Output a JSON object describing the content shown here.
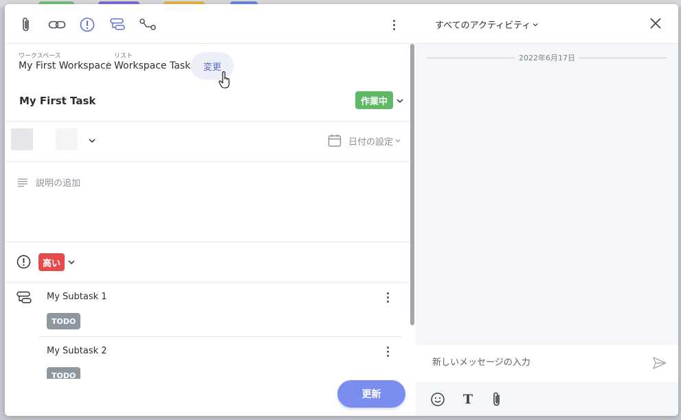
{
  "background": {
    "pill_colors": [
      "#78c27b",
      "#7d6fd6",
      "#e8b74a",
      "#6b86e0"
    ]
  },
  "toolbar": {
    "icons": [
      "paperclip-icon",
      "link-icon",
      "priority-alert-icon",
      "subtask-icon",
      "dependency-icon",
      "more-options-icon"
    ]
  },
  "breadcrumb": {
    "workspace_label": "ワークスペース",
    "workspace_name": "My First Workspace",
    "separator": "/",
    "list_label": "リスト",
    "list_name": "Workspace Tasks",
    "change_label": "変更"
  },
  "task": {
    "title": "My First Task",
    "status": "作業中",
    "status_color": "#5fb865",
    "date_label": "日付の設定",
    "description_placeholder": "説明の追加",
    "priority": "高い",
    "priority_color": "#e64a4a"
  },
  "subtasks": [
    {
      "name": "My Subtask 1",
      "status": "TODO"
    },
    {
      "name": "My Subtask 2",
      "status": "TODO"
    }
  ],
  "actions": {
    "update_label": "更新",
    "update_color": "#7b8ef0"
  },
  "activity": {
    "filter_label": "すべてのアクティビティ",
    "date_divider": "2022年6月17日",
    "message_placeholder": "新しいメッセージの入力"
  }
}
